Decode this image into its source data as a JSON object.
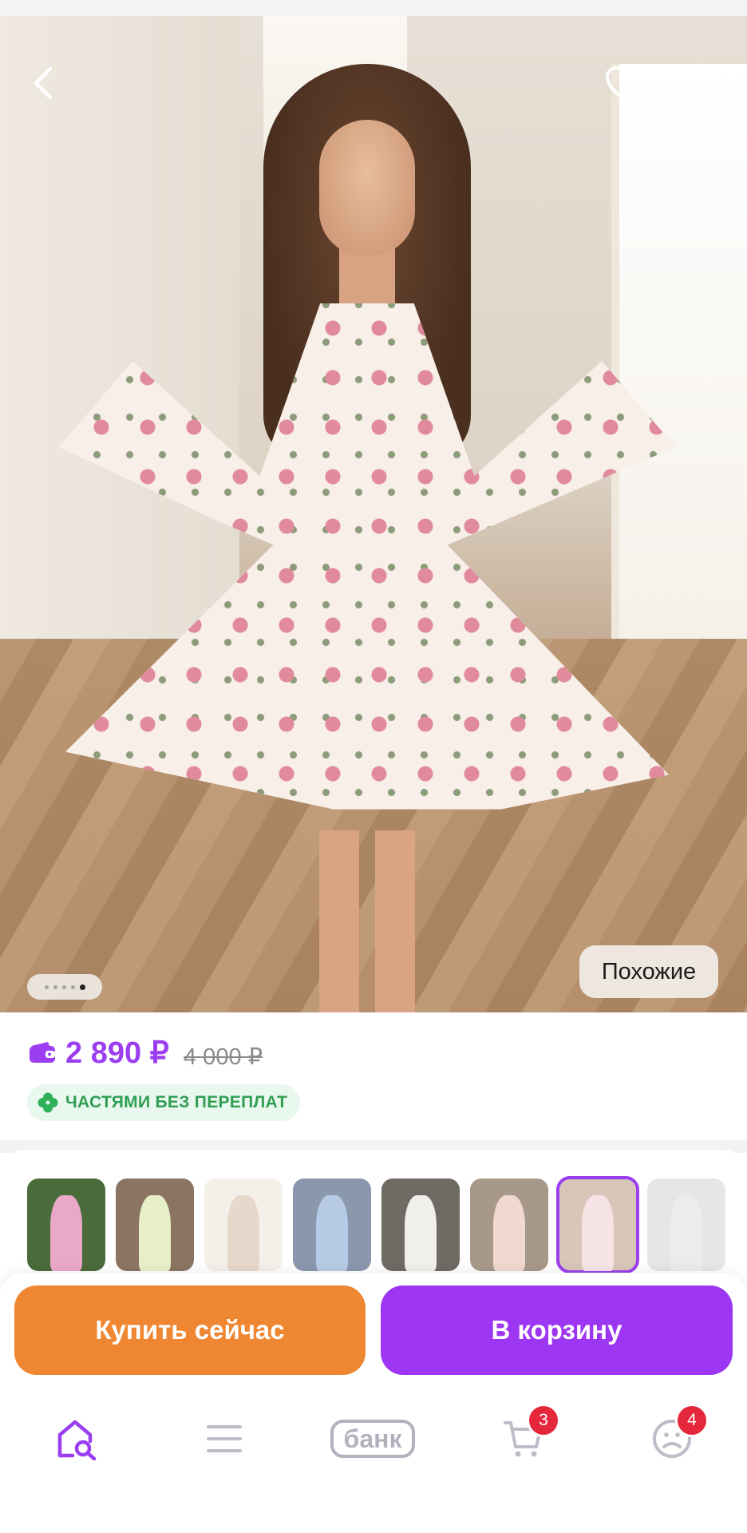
{
  "product": {
    "image_alt": "floral-dress-photo",
    "gallery_total": 5,
    "gallery_active_index": 4,
    "similar_label": "Похожие"
  },
  "pricing": {
    "price": "2 890 ₽",
    "old_price": "4 000 ₽",
    "installment_label": "ЧАСТЯМИ БЕЗ ПЕРЕПЛАТ"
  },
  "variants": {
    "selected_index": 6,
    "thumbnails": [
      {
        "icon": "variant-thumb-pink-dress",
        "colors": [
          "#4b6b3a",
          "#e9a8c8"
        ]
      },
      {
        "icon": "variant-thumb-green-floral",
        "colors": [
          "#8b7462",
          "#e7efc9"
        ]
      },
      {
        "icon": "variant-thumb-polka-dot",
        "colors": [
          "#f4efe8",
          "#e8d8cb"
        ]
      },
      {
        "icon": "variant-thumb-blue-dress",
        "colors": [
          "#8a97ad",
          "#b8cbe6"
        ]
      },
      {
        "icon": "variant-thumb-black-floral",
        "colors": [
          "#6f6a63",
          "#f1efe9"
        ]
      },
      {
        "icon": "variant-thumb-red-floral",
        "colors": [
          "#a8988a",
          "#f1d9d1"
        ]
      },
      {
        "icon": "variant-thumb-current-dress",
        "colors": [
          "#d8c6b8",
          "#f6e3e6"
        ]
      },
      {
        "icon": "variant-thumb-grey-dress",
        "colors": [
          "#c9c9cc",
          "#d7d7da"
        ]
      }
    ]
  },
  "actions": {
    "buy_now": "Купить сейчас",
    "add_to_cart": "В корзину"
  },
  "nav": {
    "bank_label": "банк",
    "cart_badge": "3",
    "profile_badge": "4"
  },
  "colors": {
    "accent_purple": "#9b3ef0",
    "buy_orange": "#ef8631",
    "badge_red": "#e5273c",
    "installment_green": "#2f9e52"
  }
}
